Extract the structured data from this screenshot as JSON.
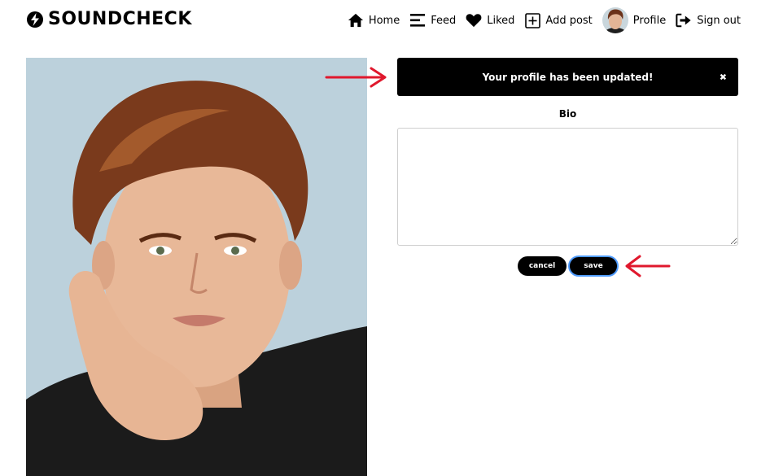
{
  "brand": {
    "name": "SOUNDCHECK",
    "icon": "lightning-disc-icon"
  },
  "nav": {
    "home": "Home",
    "feed": "Feed",
    "liked": "Liked",
    "add_post": "Add post",
    "profile": "Profile",
    "sign_out": "Sign out"
  },
  "alert": {
    "message": "Your profile has been updated!",
    "close": "✖"
  },
  "form": {
    "bio_label": "Bio",
    "bio_value": "",
    "cancel_label": "cancel",
    "save_label": "save"
  },
  "colors": {
    "annotation_arrow": "#e0182d",
    "save_focus_ring": "#4f9bff",
    "photo_background": "#bcd1dc"
  }
}
